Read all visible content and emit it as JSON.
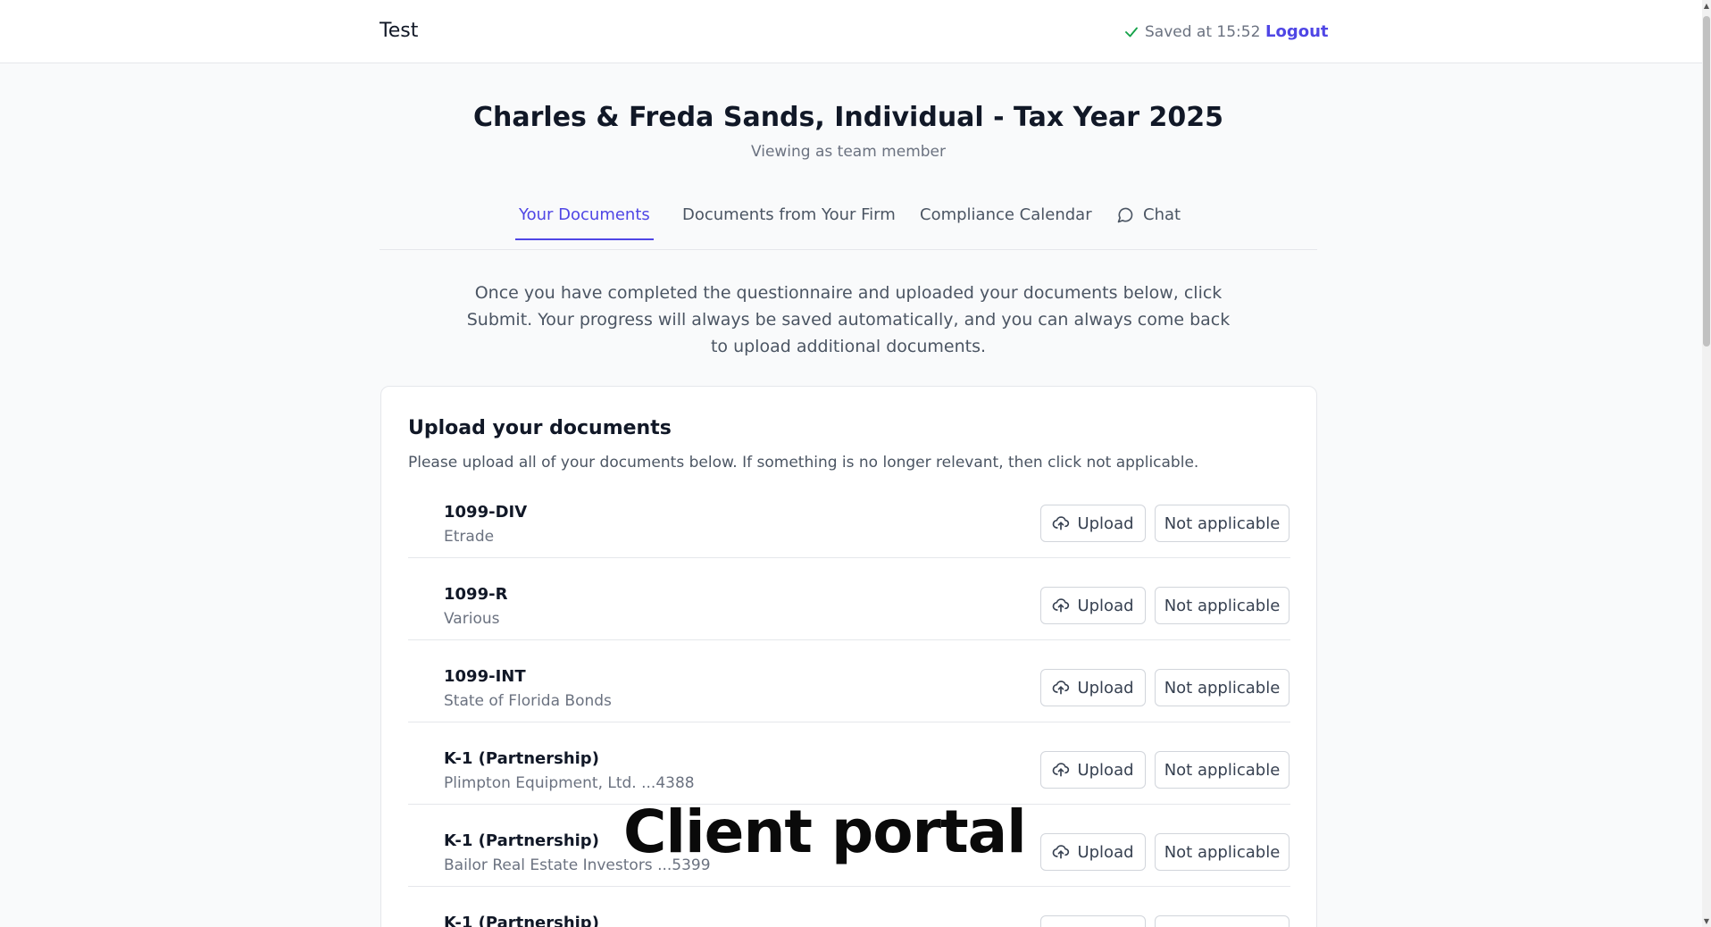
{
  "header": {
    "brand": "Test",
    "saved_status": "Saved at 15:52",
    "logout_label": "Logout"
  },
  "page": {
    "title": "Charles & Freda Sands, Individual - Tax Year 2025",
    "subtitle": "Viewing as team member"
  },
  "tabs": [
    {
      "label": "Your Documents",
      "active": true
    },
    {
      "label": "Documents from Your Firm"
    },
    {
      "label": "Compliance Calendar"
    },
    {
      "label": "Chat",
      "icon": "chat-bubble-icon"
    }
  ],
  "intro_text": "Once you have completed the questionnaire and uploaded your documents below, click Submit. Your progress will always be saved automatically, and you can always come back to upload additional documents.",
  "upload_card": {
    "title": "Upload your documents",
    "subtitle": "Please upload all of your documents below. If something is no longer relevant, then click not applicable.",
    "upload_label": "Upload",
    "na_label": "Not applicable",
    "documents": [
      {
        "name": "1099-DIV",
        "source": "Etrade"
      },
      {
        "name": "1099-R",
        "source": "Various"
      },
      {
        "name": "1099-INT",
        "source": "State of Florida Bonds"
      },
      {
        "name": "K-1 (Partnership)",
        "source": "Plimpton Equipment, Ltd. ...4388"
      },
      {
        "name": "K-1 (Partnership)",
        "source": "Bailor Real Estate Investors ...5399"
      },
      {
        "name": "K-1 (Partnership)",
        "source": ""
      }
    ]
  },
  "overlay_caption": "Client portal",
  "colors": {
    "accent": "#4f46e5",
    "check": "#16a34a",
    "background": "#f9fafb"
  }
}
